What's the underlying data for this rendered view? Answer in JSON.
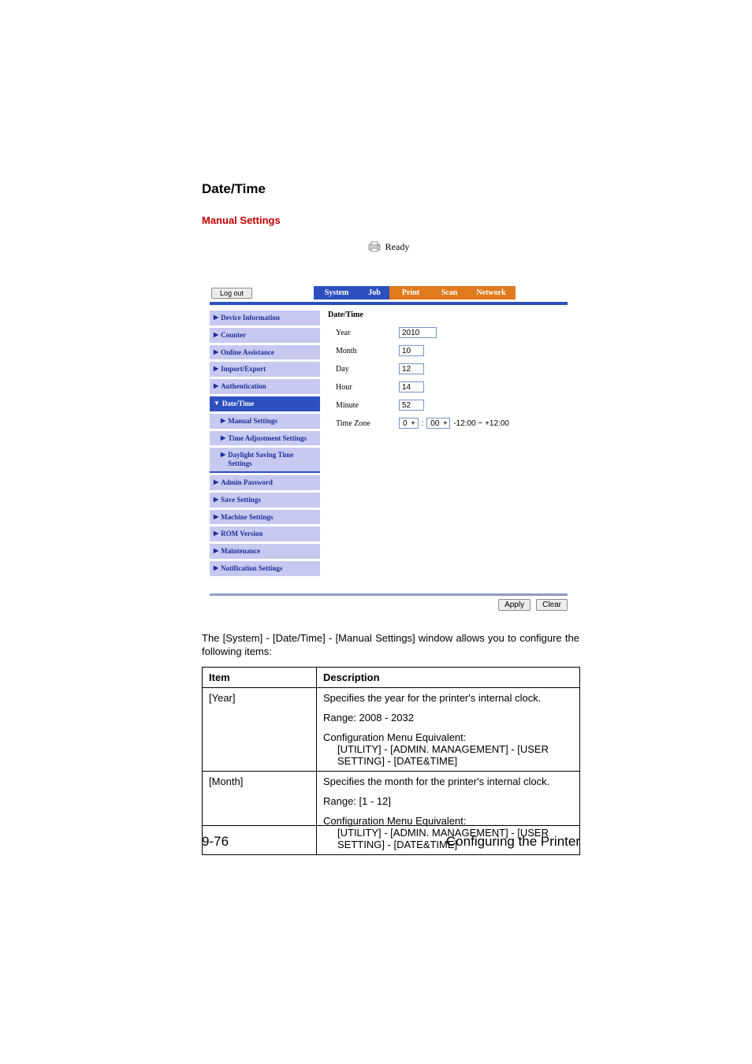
{
  "headings": {
    "date_time": "Date/Time",
    "manual_settings": "Manual Settings"
  },
  "status": {
    "text": "Ready"
  },
  "topbar": {
    "logout": "Log out"
  },
  "tabs": {
    "system": "System",
    "job": "Job",
    "print": "Print",
    "scan": "Scan",
    "network": "Network"
  },
  "sidebar": {
    "device_info": "Device Information",
    "counter": "Counter",
    "online_assist": "Online Assistance",
    "import_export": "Import/Export",
    "authentication": "Authentication",
    "date_time": "Date/Time",
    "manual_settings": "Manual Settings",
    "time_adj": "Time Adjustment Settings",
    "dst": "Daylight Saving Time Settings",
    "admin_pw": "Admin Password",
    "save_settings": "Save Settings",
    "machine_settings": "Machine Settings",
    "rom_version": "ROM Version",
    "maintenance": "Maintenance",
    "notification": "Notification Settings"
  },
  "form": {
    "section_title": "Date/Time",
    "year_label": "Year",
    "year_value": "2010",
    "month_label": "Month",
    "month_value": "10",
    "day_label": "Day",
    "day_value": "12",
    "hour_label": "Hour",
    "hour_value": "14",
    "minute_label": "Minute",
    "minute_value": "52",
    "tz_label": "Time Zone",
    "tz_hour": "0",
    "tz_sep": ":",
    "tz_min": "00",
    "tz_range": "-12:00 ~ +12:00"
  },
  "actions": {
    "apply": "Apply",
    "clear": "Clear"
  },
  "paragraph": "The [System] - [Date/Time] - [Manual Settings] window allows you to configure the following items:",
  "table": {
    "head_item": "Item",
    "head_desc": "Description",
    "rows": [
      {
        "item": "[Year]",
        "line1": "Specifies the year for the printer's internal clock.",
        "range": "Range:   2008 - 2032",
        "cfg_label": "Configuration Menu Equivalent:",
        "cfg_path": "[UTILITY] - [ADMIN. MANAGEMENT] - [USER SETTING] - [DATE&TIME]"
      },
      {
        "item": "[Month]",
        "line1": "Specifies the month for the printer's internal clock.",
        "range": "Range:   [1 - 12]",
        "cfg_label": "Configuration Menu Equivalent:",
        "cfg_path": "[UTILITY] - [ADMIN. MANAGEMENT] - [USER SETTING] - [DATE&TIME]"
      }
    ]
  },
  "footer": {
    "left": "9-76",
    "right": "Configuring the Printer"
  }
}
